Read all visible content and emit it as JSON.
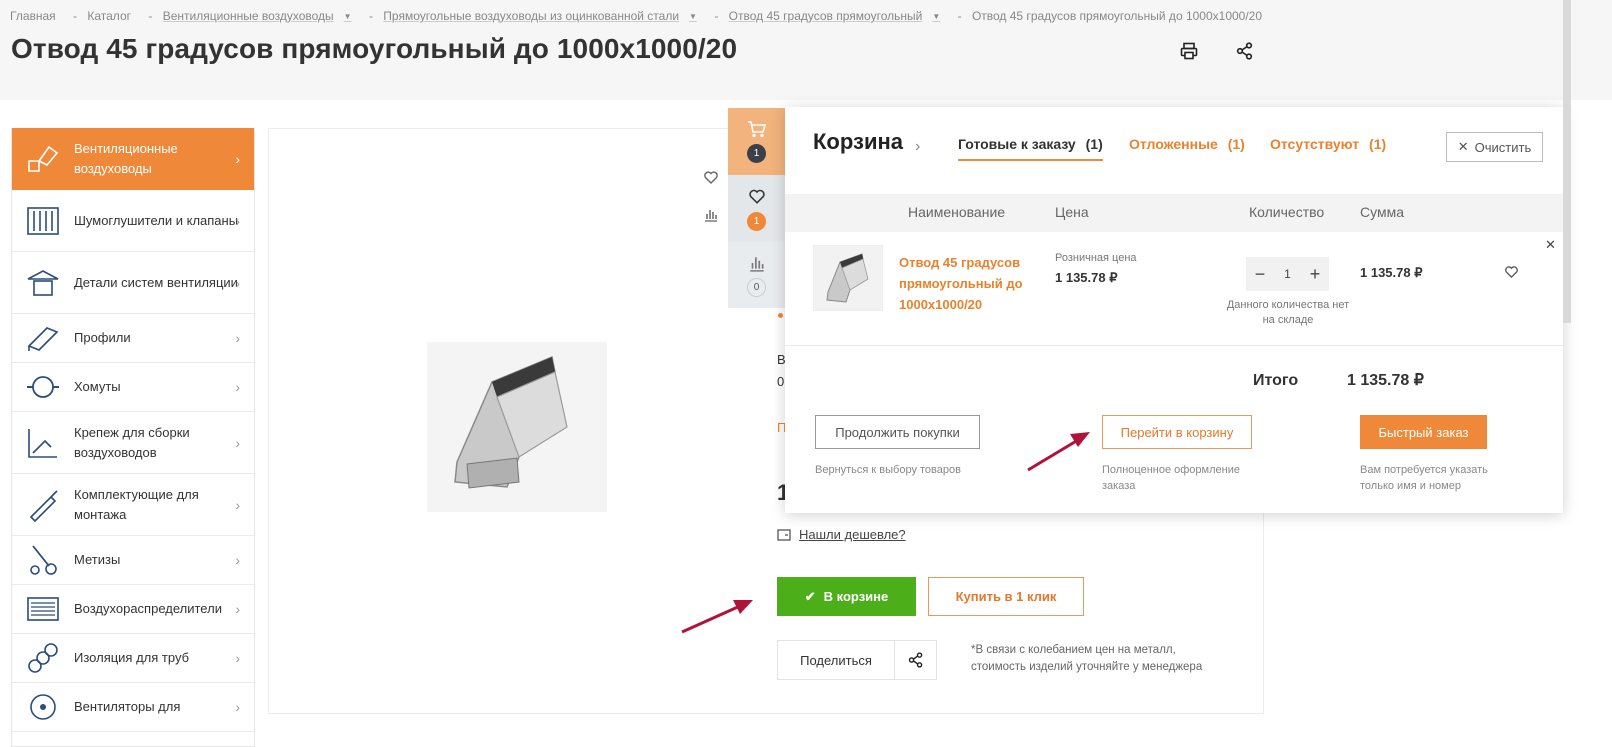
{
  "breadcrumb": {
    "items": [
      {
        "label": "Главная",
        "dropdown": false
      },
      {
        "label": "Каталог",
        "dropdown": false
      },
      {
        "label": "Вентиляционные воздуховоды",
        "dropdown": true
      },
      {
        "label": "Прямоугольные воздуховоды из оцинкованной стали",
        "dropdown": true
      },
      {
        "label": "Отвод 45 градусов прямоугольный",
        "dropdown": true
      },
      {
        "label": "Отвод 45 градусов прямоугольный до 1000x1000/20",
        "dropdown": false
      }
    ]
  },
  "page": {
    "title": "Отвод 45 градусов прямоугольный до 1000x1000/20",
    "print_icon": "printer-icon",
    "share_icon": "share-icon"
  },
  "sidebar": {
    "items": [
      {
        "label": "Вентиляционные воздуховоды",
        "icon": "duct-elbow-icon",
        "active": true
      },
      {
        "label": "Шумоглушители и клапаны",
        "icon": "silencer-icon",
        "active": false
      },
      {
        "label": "Детали систем вентиляции",
        "icon": "roof-cap-icon",
        "active": false
      },
      {
        "label": "Профили",
        "icon": "profile-icon",
        "active": false
      },
      {
        "label": "Хомуты",
        "icon": "clamp-icon",
        "active": false
      },
      {
        "label": "Крепеж для сборки воздуховодов",
        "icon": "fastener-icon",
        "active": false
      },
      {
        "label": "Комплектующие для монтажа",
        "icon": "sealant-gun-icon",
        "active": false
      },
      {
        "label": "Метизы",
        "icon": "bolts-icon",
        "active": false
      },
      {
        "label": "Воздухораспределители",
        "icon": "grille-icon",
        "active": false
      },
      {
        "label": "Изоляция для труб",
        "icon": "pipe-insulation-icon",
        "active": false
      },
      {
        "label": "Вентиляторы для",
        "icon": "fan-icon",
        "active": false
      }
    ]
  },
  "product": {
    "found_cheaper": "Нашли дешевле?",
    "in_cart_label": "В корзине",
    "buy_one_click": "Купить в 1 клик",
    "share_label": "Поделиться",
    "disclaimer": "*В связи с колебанием цен на металл, стоимость изделий уточняйте у менеджера",
    "partial_texts": [
      "В",
      "0",
      "П",
      "1"
    ]
  },
  "side_panel": {
    "cart_count": "1",
    "favorites_count": "1",
    "compare_count": "0"
  },
  "cart": {
    "title": "Корзина",
    "tabs": [
      {
        "label": "Готовые к заказу",
        "count": "(1)",
        "active": true
      },
      {
        "label": "Отложенные",
        "count": "(1)",
        "active": false
      },
      {
        "label": "Отсутствуют",
        "count": "(1)",
        "active": false
      }
    ],
    "clear_label": "Очистить",
    "columns": {
      "name": "Наименование",
      "price": "Цена",
      "quantity": "Количество",
      "sum": "Сумма"
    },
    "item": {
      "name": "Отвод 45 градусов прямоугольный до 1000x1000/20",
      "price_label": "Розничная цена",
      "price": "1 135.78 ₽",
      "quantity": "1",
      "quantity_note": "Данного количества нет на складе",
      "sum": "1 135.78 ₽"
    },
    "total_label": "Итого",
    "total_value": "1 135.78 ₽",
    "buttons": {
      "continue": "Продолжить покупки",
      "continue_note": "Вернуться к выбору товаров",
      "go_to_cart": "Перейти в корзину",
      "go_to_cart_note": "Полноценное оформление заказа",
      "fast_order": "Быстрый заказ",
      "fast_order_note": "Вам потребуется указать только имя и номер"
    }
  },
  "colors": {
    "accent": "#f0883a",
    "green": "#4caf1a",
    "arrow": "#b0123a"
  }
}
